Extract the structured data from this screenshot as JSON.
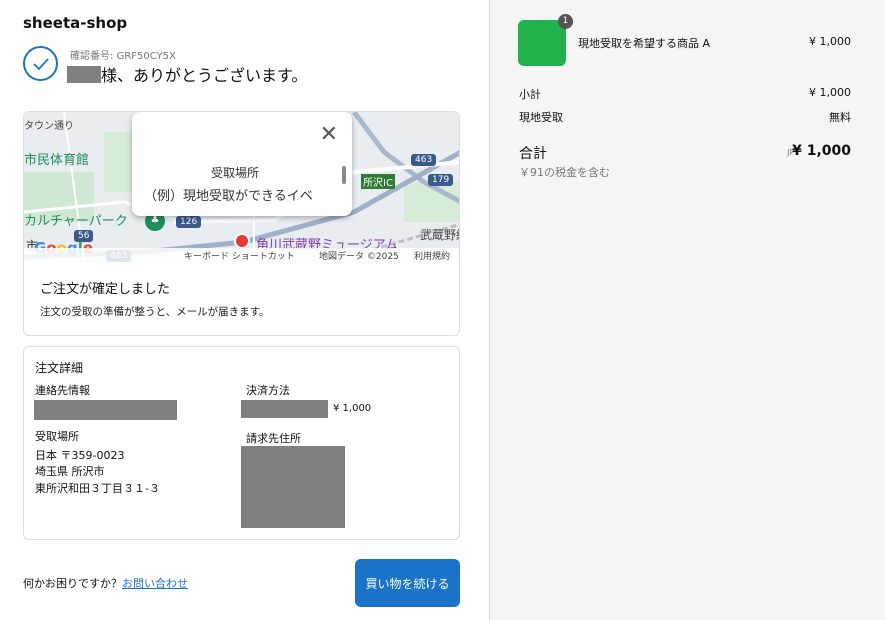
{
  "shop": {
    "name": "sheeta-shop"
  },
  "confirmation": {
    "number_label": "確認番号: GRF50CY5X",
    "thanks": "様、ありがとうございます。"
  },
  "map": {
    "labels": {
      "street": "タウン通り",
      "gym": "市民体育館",
      "culture_park": "カルチャーパーク",
      "city": "市",
      "tokorozawa_ic": "所沢IC",
      "musashino": "武蔵野線"
    },
    "road_numbers": [
      "463",
      "179",
      "126",
      "56",
      "463"
    ],
    "museum": "角川武蔵野ミュージアム",
    "google": "Google",
    "footer": {
      "shortcuts": "キーボード ショートカット",
      "map_data": "地図データ ©2025",
      "terms": "利用規約"
    },
    "popup": {
      "close": "✕",
      "title": "受取場所",
      "text": "（例）現地受取ができるイベ"
    }
  },
  "order_status": {
    "title": "ご注文が確定しました",
    "description": "注文の受取の準備が整うと、メールが届きます。"
  },
  "details": {
    "title": "注文詳細",
    "contact_label": "連絡先情報",
    "payment_label": "決済方法",
    "payment_amount": "¥ 1,000",
    "pickup_label": "受取場所",
    "pickup_address": [
      "日本 〒359-0023",
      "埼玉県 所沢市",
      "東所沢和田３丁目３１-３"
    ],
    "billing_label": "請求先住所"
  },
  "footer": {
    "help_text": "何かお困りですか？",
    "help_link": "お問い合わせ",
    "continue_button": "買い物を続ける"
  },
  "summary": {
    "item": {
      "name": "現地受取を希望する商品 A",
      "price": "¥ 1,000",
      "quantity": "1",
      "thumb_color": "#22b14c"
    },
    "subtotal_label": "小計",
    "subtotal_value": "¥ 1,000",
    "shipping_label": "現地受取",
    "shipping_value": "無料",
    "total_label": "合計",
    "total_currency": "JPY",
    "total_value": "¥ 1,000",
    "tax_note": "￥91の税金を含む"
  },
  "colors": {
    "accent": "#1a73c8",
    "sidebar_bg": "#f5f5f5",
    "redacted": "#808080"
  }
}
